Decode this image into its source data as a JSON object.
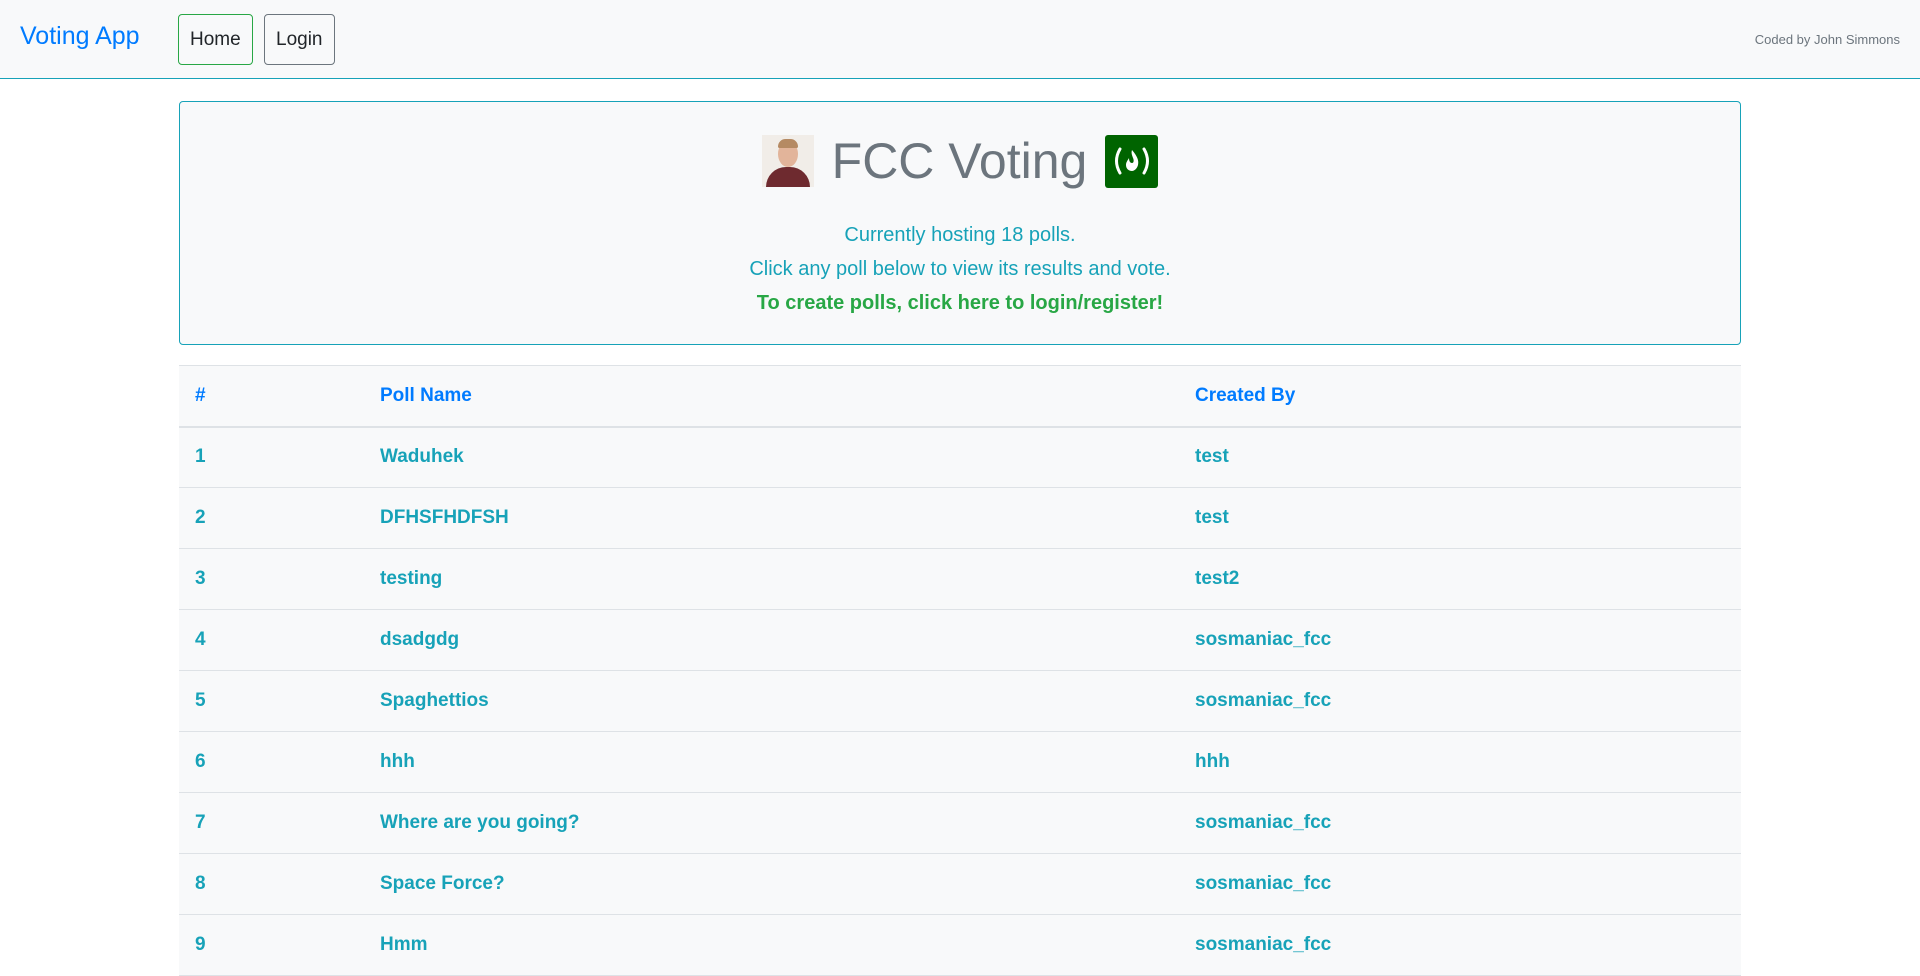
{
  "navbar": {
    "brand": "Voting App",
    "home_label": "Home",
    "login_label": "Login",
    "credit": "Coded by John Simmons"
  },
  "header": {
    "title": "FCC Voting",
    "avatar_icon": "person-avatar",
    "logo_icon": "freecodecamp-logo-icon",
    "hosting_text": "Currently hosting 18 polls.",
    "instructions": "Click any poll below to view its results and vote.",
    "login_prompt": "To create polls, click here to login/register!"
  },
  "colors": {
    "primary": "#007bff",
    "info": "#17a2b8",
    "success": "#28a745",
    "logo_green": "#006400"
  },
  "table": {
    "headers": [
      "#",
      "Poll Name",
      "Created By"
    ],
    "rows": [
      {
        "num": "1",
        "name": "Waduhek",
        "author": "test"
      },
      {
        "num": "2",
        "name": "DFHSFHDFSH",
        "author": "test"
      },
      {
        "num": "3",
        "name": "testing",
        "author": "test2"
      },
      {
        "num": "4",
        "name": "dsadgdg",
        "author": "sosmaniac_fcc"
      },
      {
        "num": "5",
        "name": "Spaghettios",
        "author": "sosmaniac_fcc"
      },
      {
        "num": "6",
        "name": "hhh",
        "author": "hhh"
      },
      {
        "num": "7",
        "name": "Where are you going?",
        "author": "sosmaniac_fcc"
      },
      {
        "num": "8",
        "name": "Space Force?",
        "author": "sosmaniac_fcc"
      },
      {
        "num": "9",
        "name": "Hmm",
        "author": "sosmaniac_fcc"
      }
    ]
  }
}
